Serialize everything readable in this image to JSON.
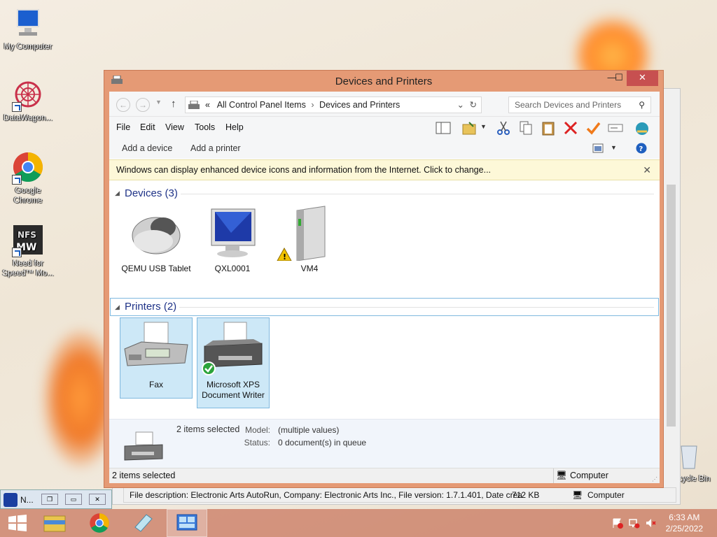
{
  "desktop": {
    "icons": [
      {
        "label": "My Computer"
      },
      {
        "label": "DataWagon..."
      },
      {
        "label": "Google Chrome"
      },
      {
        "label": "Need for Speed™ Mo..."
      },
      {
        "label": "Recycle Bin"
      }
    ]
  },
  "window": {
    "title": "Devices and Printers",
    "minimize": "—",
    "maximize": "☐",
    "close": "✕",
    "address": {
      "prefix": "«",
      "crumbs": [
        "All Control Panel Items",
        "Devices and Printers"
      ],
      "separator": "›"
    },
    "search_placeholder": "Search Devices and Printers",
    "menu": [
      "File",
      "Edit",
      "View",
      "Tools",
      "Help"
    ],
    "commands": {
      "add_device": "Add a device",
      "add_printer": "Add a printer"
    },
    "infobar": "Windows can display enhanced device icons and information from the Internet. Click to change...",
    "groups": {
      "devices": {
        "header": "Devices (3)",
        "items": [
          {
            "label": "QEMU USB Tablet",
            "icon": "mouse-icon"
          },
          {
            "label": "QXL0001",
            "icon": "monitor-icon"
          },
          {
            "label": "VM4",
            "icon": "drive-icon"
          }
        ]
      },
      "printers": {
        "header": "Printers (2)",
        "items": [
          {
            "label": "Fax",
            "icon": "fax-icon",
            "selected": true
          },
          {
            "label": "Microsoft XPS Document Writer",
            "icon": "printer-icon",
            "selected": true
          }
        ]
      }
    },
    "details": {
      "selected_count": "2 items selected",
      "model_label": "Model:",
      "model_value": "(multiple values)",
      "status_label": "Status:",
      "status_value": "0 document(s) in queue"
    },
    "status": {
      "left": "2 items selected",
      "right": "Computer"
    }
  },
  "background_window": {
    "status_text": "File description: Electronic Arts AutoRun, Company: Electronic Arts Inc., File version: 1.7.1.401, Date crea",
    "size": "712 KB",
    "location": "Computer"
  },
  "mini_window": {
    "label": "N..."
  },
  "taskbar": {
    "time": "6:33 AM",
    "date": "2/25/2022"
  },
  "colors": {
    "window_frame": "#e59a75",
    "close_button": "#c75050",
    "selection": "#cde8f7",
    "infobar": "#fdf8d8"
  }
}
